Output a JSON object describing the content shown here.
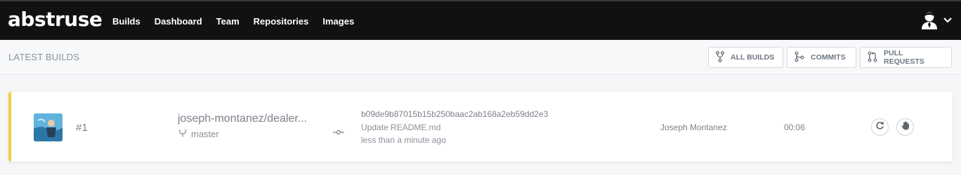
{
  "app": {
    "logo": "abstruse"
  },
  "nav": {
    "items": [
      "Builds",
      "Dashboard",
      "Team",
      "Repositories",
      "Images"
    ]
  },
  "user": {
    "icon": "user-avatar-icon",
    "menu_icon": "chevron-down-icon"
  },
  "subheader": {
    "title": "LATEST BUILDS",
    "buttons": [
      {
        "label": "ALL BUILDS",
        "icon": "fork-icon"
      },
      {
        "label": "COMMITS",
        "icon": "commit-branch-icon"
      },
      {
        "label": "PULL REQUESTS",
        "icon": "pull-request-icon"
      }
    ]
  },
  "builds": [
    {
      "number": "#1",
      "repo": "joseph-montanez/dealer...",
      "branch": "master",
      "sha": "b09de9b87015b15b250baac2ab168a2eb59dd2e3",
      "message": "Update README.md",
      "time": "less than a minute ago",
      "author": "Joseph Montanez",
      "duration": "00:06",
      "status_color": "#f2d040"
    }
  ]
}
